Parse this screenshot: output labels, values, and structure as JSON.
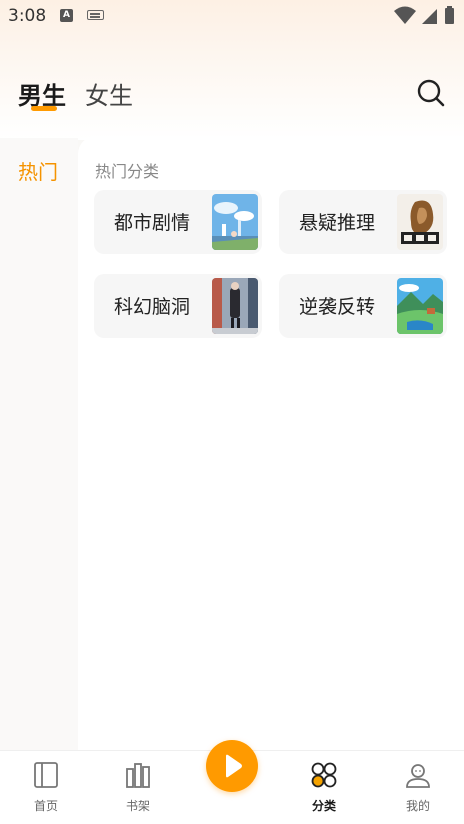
{
  "status_bar": {
    "time": "3:08",
    "a_icon_letter": "A"
  },
  "header": {
    "tabs": [
      {
        "label": "男生",
        "active": true
      },
      {
        "label": "女生",
        "active": false
      }
    ],
    "search_icon": "search-icon",
    "accent_color": "#ff9a00"
  },
  "sidebar": {
    "items": [
      {
        "label": "热门",
        "active": true
      }
    ]
  },
  "main": {
    "section_title": "热门分类",
    "categories": [
      {
        "label": "都市剧情",
        "cover": "city-anime-cover"
      },
      {
        "label": "悬疑推理",
        "cover": "mystery-squirrel-cover"
      },
      {
        "label": "科幻脑洞",
        "cover": "scifi-street-cover"
      },
      {
        "label": "逆袭反转",
        "cover": "landscape-cover"
      }
    ]
  },
  "bottom_nav": {
    "items": [
      {
        "label": "首页",
        "icon": "book-icon",
        "active": false
      },
      {
        "label": "书架",
        "icon": "bookshelf-icon",
        "active": false
      },
      {
        "label": "分类",
        "icon": "category-icon",
        "active": true
      },
      {
        "label": "我的",
        "icon": "profile-icon",
        "active": false
      }
    ],
    "play_icon": "play-icon"
  }
}
